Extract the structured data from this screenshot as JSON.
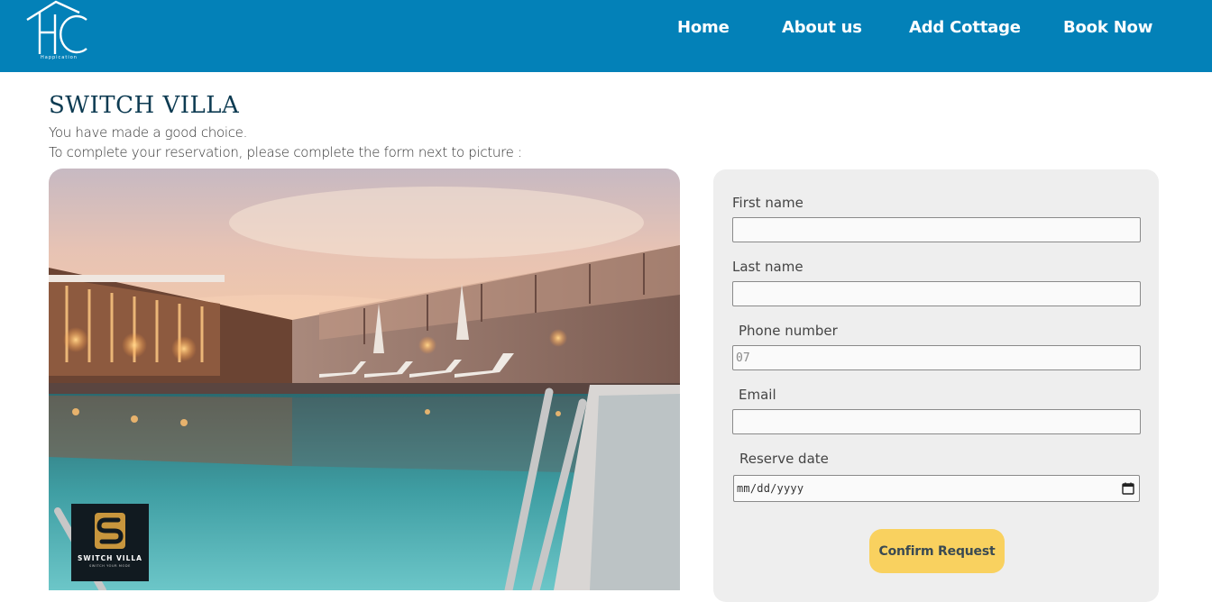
{
  "header": {
    "logo_icon": "house-hc-logo",
    "logo_tagline": "Happication",
    "nav": [
      {
        "label": "Home"
      },
      {
        "label": "About us"
      },
      {
        "label": "Add Cottage"
      },
      {
        "label": "Book Now"
      }
    ]
  },
  "page": {
    "title": "SWITCH VILLA",
    "intro_line1": "You have made a good choice.",
    "intro_line2": "To complete your reservation, please complete the form next to picture :"
  },
  "photo": {
    "subject": "villa-pool-at-dusk",
    "logo_text": "SWITCH VILLA",
    "logo_sub": "SWITCH YOUR MODE"
  },
  "form": {
    "first_name": {
      "label": "First name",
      "value": "",
      "placeholder": ""
    },
    "last_name": {
      "label": "Last name",
      "value": "",
      "placeholder": ""
    },
    "phone": {
      "label": "Phone number",
      "value": "",
      "placeholder": "07"
    },
    "email": {
      "label": "Email",
      "value": "",
      "placeholder": ""
    },
    "reserve_date": {
      "label": "Reserve date",
      "placeholder": "mm/dd/yyyy"
    },
    "submit_label": "Confirm Request"
  },
  "colors": {
    "header_bg": "#0381b8",
    "title": "#0d3b52",
    "form_bg": "#eeeeee",
    "button_bg": "#f9d15f"
  }
}
